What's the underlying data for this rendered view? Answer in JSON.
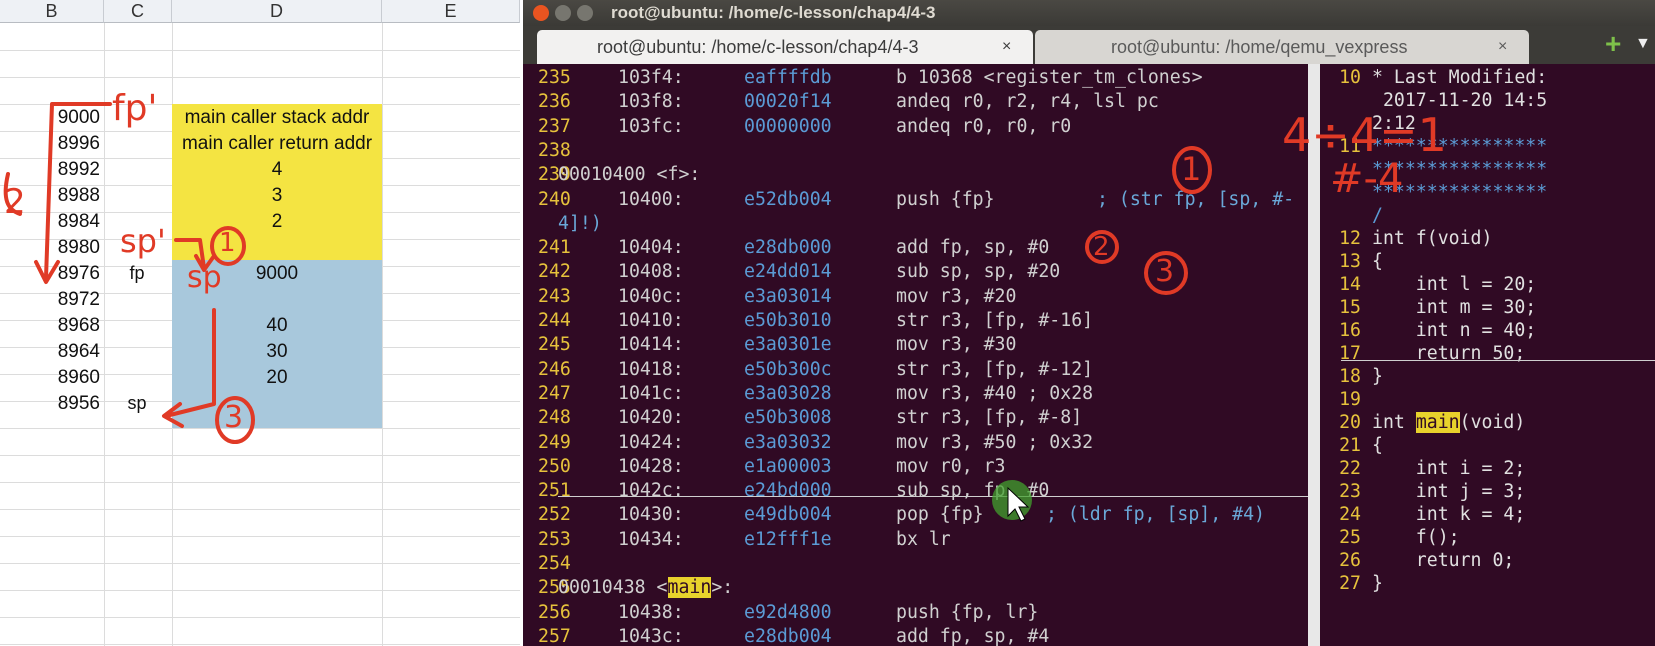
{
  "sheet": {
    "columns": [
      "B",
      "C",
      "D",
      "E"
    ],
    "rows": [
      {
        "b": "9000",
        "c": "",
        "d": "main caller stack addr"
      },
      {
        "b": "8996",
        "c": "",
        "d": "main caller return addr"
      },
      {
        "b": "8992",
        "c": "",
        "d": "4"
      },
      {
        "b": "8988",
        "c": "",
        "d": "3"
      },
      {
        "b": "8984",
        "c": "",
        "d": "2"
      },
      {
        "b": "8980",
        "c": "",
        "d": ""
      },
      {
        "b": "8976",
        "c": "fp",
        "d": "9000"
      },
      {
        "b": "8972",
        "c": "",
        "d": ""
      },
      {
        "b": "8968",
        "c": "",
        "d": "40"
      },
      {
        "b": "8964",
        "c": "",
        "d": "30"
      },
      {
        "b": "8960",
        "c": "",
        "d": "20"
      },
      {
        "b": "8956",
        "c": "sp",
        "d": ""
      }
    ]
  },
  "annotations": {
    "fp_prime": "fp'",
    "sp_prime": "sp'",
    "sp_mark": "sp",
    "circle_1": "1",
    "circle_2": "2",
    "circle_3": "3",
    "bracket_2": "2",
    "div_note": "4÷4=1",
    "offset_note": "#-4"
  },
  "terminal": {
    "window_title": "root@ubuntu: /home/c-lesson/chap4/4-3",
    "tabs": [
      {
        "label": "root@ubuntu: /home/c-lesson/chap4/4-3",
        "active": true
      },
      {
        "label": "root@ubuntu: /home/qemu_vexpress",
        "active": false
      }
    ],
    "add_tab": "+",
    "tab_menu": "▼",
    "close_glyph": "×"
  },
  "disasm": [
    {
      "n": "235",
      "addr": "103f4",
      "hex": "eaffffdb",
      "ins": "b   10368 <register_tm_clones>"
    },
    {
      "n": "236",
      "addr": "103f8",
      "hex": "00020f14",
      "ins": "andeq   r0, r2, r4, lsl pc"
    },
    {
      "n": "237",
      "addr": "103fc",
      "hex": "00000000",
      "ins": "andeq   r0, r0, r0"
    },
    {
      "n": "238",
      "addr": "",
      "hex": "",
      "ins": ""
    },
    {
      "n": "239",
      "label": "00010400 <f>:"
    },
    {
      "n": "240",
      "addr": "10400",
      "hex": "e52db004",
      "ins": "push    {fp}",
      "cmt": "; (str fp, [sp, #-"
    },
    {
      "n": "",
      "wrap": "4]!)"
    },
    {
      "n": "241",
      "addr": "10404",
      "hex": "e28db000",
      "ins": "add fp, sp, #0"
    },
    {
      "n": "242",
      "addr": "10408",
      "hex": "e24dd014",
      "ins": "sub sp, sp, #20"
    },
    {
      "n": "243",
      "addr": "1040c",
      "hex": "e3a03014",
      "ins": "mov r3, #20"
    },
    {
      "n": "244",
      "addr": "10410",
      "hex": "e50b3010",
      "ins": "str r3, [fp, #-16]"
    },
    {
      "n": "245",
      "addr": "10414",
      "hex": "e3a0301e",
      "ins": "mov r3, #30"
    },
    {
      "n": "246",
      "addr": "10418",
      "hex": "e50b300c",
      "ins": "str r3, [fp, #-12]"
    },
    {
      "n": "247",
      "addr": "1041c",
      "hex": "e3a03028",
      "ins": "mov r3, #40 ; 0x28"
    },
    {
      "n": "248",
      "addr": "10420",
      "hex": "e50b3008",
      "ins": "str r3, [fp, #-8]"
    },
    {
      "n": "249",
      "addr": "10424",
      "hex": "e3a03032",
      "ins": "mov r3, #50 ; 0x32"
    },
    {
      "n": "250",
      "addr": "10428",
      "hex": "e1a00003",
      "ins": "mov r0, r3"
    },
    {
      "n": "251",
      "addr": "1042c",
      "hex": "e24bd000",
      "ins": "sub sp, fp, #0"
    },
    {
      "n": "252",
      "addr": "10430",
      "hex": "e49db004",
      "ins": "pop {fp}",
      "cmt": "; (ldr fp, [sp], #4)"
    },
    {
      "n": "253",
      "addr": "10434",
      "hex": "e12fff1e",
      "ins": "bx  lr"
    },
    {
      "n": "254",
      "addr": "",
      "hex": "",
      "ins": ""
    },
    {
      "n": "255",
      "label_pre": "00010438 <",
      "label_hl": "main",
      "label_post": ">:"
    },
    {
      "n": "256",
      "addr": "10438",
      "hex": "e92d4800",
      "ins": "push    {fp, lr}"
    },
    {
      "n": "257",
      "addr": "1043c",
      "hex": "e28db004",
      "ins": "add fp, sp, #4"
    }
  ],
  "source": [
    {
      "n": "10",
      "t": "* Last Modified:"
    },
    {
      "n": "",
      "t": " 2017-11-20 14:5"
    },
    {
      "n": "",
      "t": "2:12"
    },
    {
      "n": "11",
      "t": "****************",
      "stars": true
    },
    {
      "n": "",
      "t": "****************",
      "stars": true
    },
    {
      "n": "",
      "t": "****************",
      "stars": true
    },
    {
      "n": "",
      "t": "/",
      "stars": true
    },
    {
      "n": "12",
      "t": "int f(void)"
    },
    {
      "n": "13",
      "t": "{"
    },
    {
      "n": "14",
      "t": "    int l = 20;"
    },
    {
      "n": "15",
      "t": "    int m = 30;"
    },
    {
      "n": "16",
      "t": "    int n = 40;"
    },
    {
      "n": "17",
      "t": "    return 50;"
    },
    {
      "n": "18",
      "t": "}"
    },
    {
      "n": "19",
      "t": ""
    },
    {
      "n": "20",
      "t_pre": "int ",
      "t_hl": "main",
      "t_post": "(void)"
    },
    {
      "n": "21",
      "t": "{"
    },
    {
      "n": "22",
      "t": "    int i = 2;"
    },
    {
      "n": "23",
      "t": "    int j = 3;"
    },
    {
      "n": "24",
      "t": "    int k = 4;"
    },
    {
      "n": "25",
      "t": "    f();"
    },
    {
      "n": "26",
      "t": "    return 0;"
    },
    {
      "n": "27",
      "t": "}"
    }
  ],
  "colors": {
    "terminal_bg": "#300a24",
    "line_number": "#e6c23c",
    "hex": "#5b9bd5",
    "highlight": "#e8d22c",
    "sheet_yellow": "#f4e442",
    "sheet_blue": "#a8c8dc",
    "ink": "#e03a26"
  }
}
